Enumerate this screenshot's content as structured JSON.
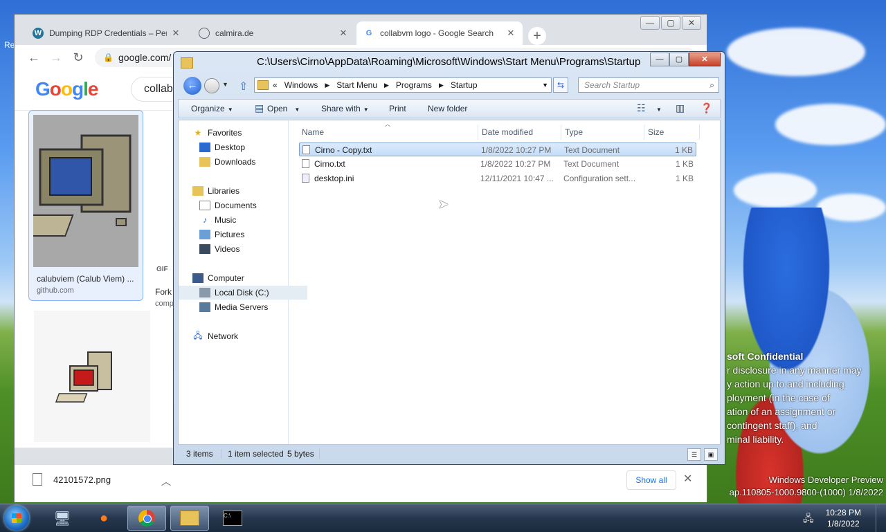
{
  "desktop": {
    "side_label": "Re",
    "watermark_title": "soft Confidential",
    "watermark_lines": [
      "r disclosure in any manner may",
      "y action up to and including",
      "ployment (in the case of",
      "ation of an assignment or",
      "contingent staff), and",
      "minal liability."
    ],
    "build_lines": [
      "Windows Developer Preview",
      "ap.110805-1000.9800-(1000) 1/8/2022"
    ]
  },
  "chrome": {
    "tabs": [
      {
        "title": "Dumping RDP Credentials – Pene",
        "icon": "wordpress-icon",
        "active": false
      },
      {
        "title": "calmira.de",
        "icon": "globe-icon",
        "active": false
      },
      {
        "title": "collabvm logo - Google Search",
        "icon": "google-icon",
        "active": true
      }
    ],
    "url": "google.com/",
    "search_query": "collab",
    "logo_letters": [
      "G",
      "o",
      "o",
      "g",
      "l",
      "e"
    ],
    "results": [
      {
        "caption": "calubviem (Calub Viem) ...",
        "source": "github.com"
      }
    ],
    "partial_caption": "Fork",
    "partial_source": "comp",
    "gif_badge": "GIF",
    "download": {
      "filename": "42101572.png",
      "show_all": "Show all"
    }
  },
  "explorer": {
    "title": "C:\\Users\\Cirno\\AppData\\Roaming\\Microsoft\\Windows\\Start Menu\\Programs\\Startup",
    "breadcrumb": [
      "Windows",
      "Start Menu",
      "Programs",
      "Startup"
    ],
    "breadcrumb_prefix": "«",
    "search_placeholder": "Search Startup",
    "commands": {
      "organize": "Organize",
      "open": "Open",
      "share": "Share with",
      "print": "Print",
      "new_folder": "New folder"
    },
    "nav": {
      "favorites": "Favorites",
      "desktop": "Desktop",
      "downloads": "Downloads",
      "libraries": "Libraries",
      "documents": "Documents",
      "music": "Music",
      "pictures": "Pictures",
      "videos": "Videos",
      "computer": "Computer",
      "local_disk": "Local Disk (C:)",
      "media_servers": "Media Servers",
      "network": "Network"
    },
    "columns": {
      "name": "Name",
      "date": "Date modified",
      "type": "Type",
      "size": "Size"
    },
    "files": [
      {
        "name": "Cirno - Copy.txt",
        "date": "1/8/2022 10:27 PM",
        "type": "Text Document",
        "size": "1 KB"
      },
      {
        "name": "Cirno.txt",
        "date": "1/8/2022 10:27 PM",
        "type": "Text Document",
        "size": "1 KB"
      },
      {
        "name": "desktop.ini",
        "date": "12/11/2021 10:47 ...",
        "type": "Configuration sett...",
        "size": "1 KB"
      }
    ],
    "status": {
      "count": "3 items",
      "selected": "1 item selected",
      "bytes": "5 bytes"
    }
  },
  "taskbar": {
    "time": "10:28 PM",
    "date": "1/8/2022"
  }
}
